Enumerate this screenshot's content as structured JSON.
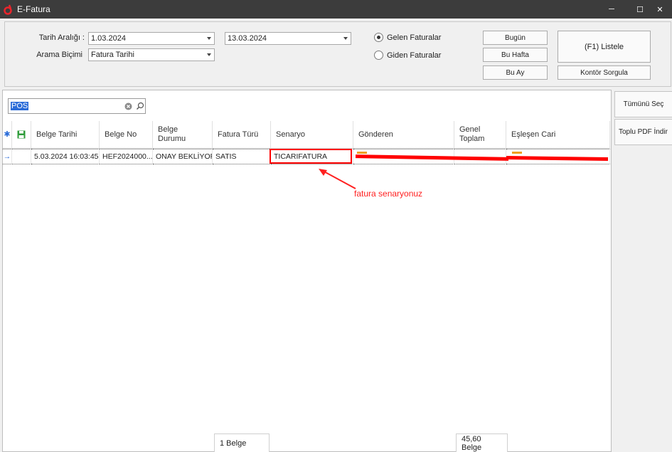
{
  "window": {
    "title": "E-Fatura",
    "minimize_glyph": "─",
    "maximize_glyph": "☐",
    "close_glyph": "✕",
    "app_icon": "dolphin-logo-icon"
  },
  "filters": {
    "date_range_label": "Tarih Aralığı :",
    "date_from": "1.03.2024",
    "date_to": "13.03.2024",
    "search_mode_label": "Arama Biçimi",
    "search_mode_value": "Fatura Tarihi",
    "radio_incoming": "Gelen Faturalar",
    "radio_outgoing": "Giden Faturalar",
    "selected_radio": "incoming",
    "btn_today": "Bugün",
    "btn_this_week": "Bu Hafta",
    "btn_this_month": "Bu Ay",
    "btn_list": "(F1) Listele",
    "btn_credit_query": "Kontör Sorgula"
  },
  "search": {
    "value": "POS"
  },
  "grid": {
    "columns": [
      "Belge Tarihi",
      "Belge No",
      "Belge Durumu",
      "Fatura Türü",
      "Senaryo",
      "Gönderen",
      "Genel Toplam",
      "Eşleşen Cari"
    ],
    "rows": [
      {
        "belge_tarihi": "5.03.2024 16:03:45",
        "belge_no": "HEF2024000...",
        "belge_durumu": "ONAY BEKLİYOR",
        "fatura_turu": "SATIS",
        "senaryo": "TICARIFATURA",
        "gonderen": "",
        "genel_toplam": "",
        "eslesen_cari": ""
      }
    ],
    "footer_count": "1 Belge",
    "footer_total": "45,60 Belge"
  },
  "side_buttons": {
    "select_all": "Tümünü Seç",
    "bulk_pdf": "Toplu PDF İndir"
  },
  "annotation": {
    "text": "fatura senaryonuz",
    "color": "#ff2020"
  },
  "colors": {
    "titlebar": "#3c3c3c",
    "highlight": "#ff0000",
    "selection": "#2b6cd8"
  }
}
